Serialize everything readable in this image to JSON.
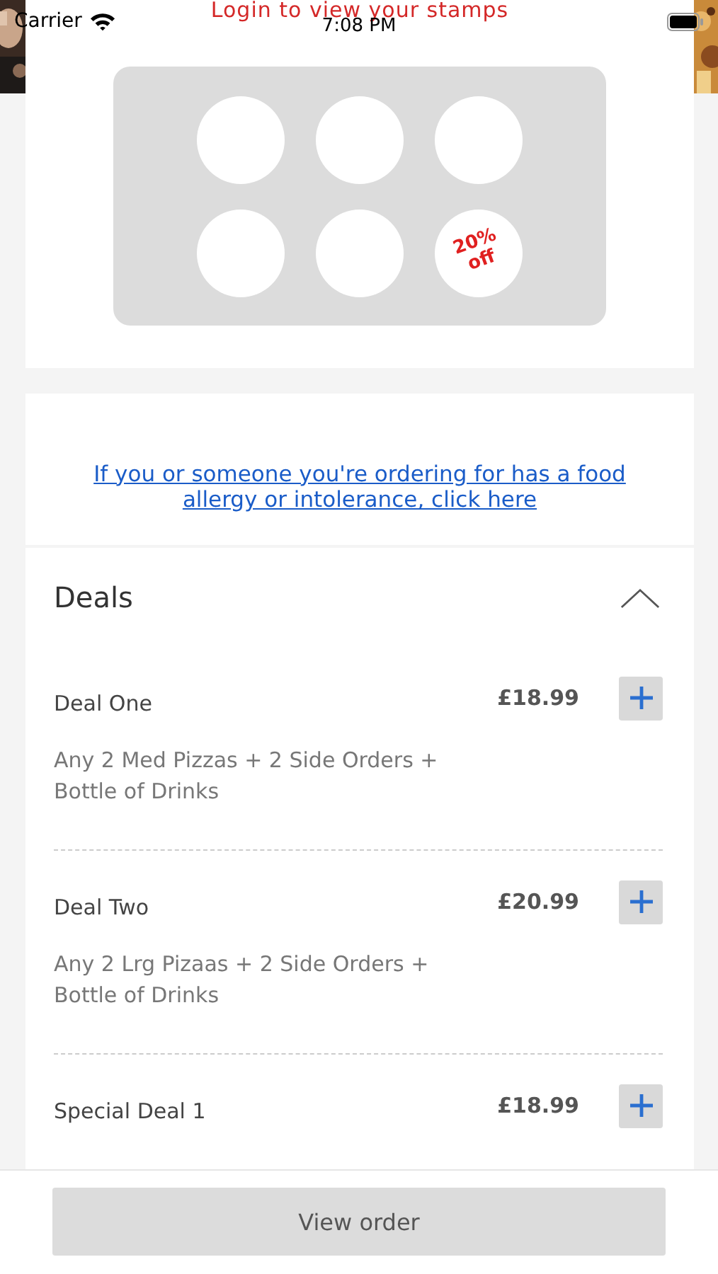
{
  "status_bar": {
    "carrier": "Carrier",
    "time": "7:08 PM"
  },
  "loyalty": {
    "title": "Login to view your stamps",
    "stamps": [
      {
        "kind": "empty"
      },
      {
        "kind": "empty"
      },
      {
        "kind": "empty"
      },
      {
        "kind": "empty"
      },
      {
        "kind": "empty"
      },
      {
        "kind": "reward",
        "label": "20% off"
      }
    ]
  },
  "allergy_link": "If you or someone you're ordering for has a food allergy or intolerance, click here",
  "deals": {
    "title": "Deals",
    "expanded": true,
    "items": [
      {
        "name": "Deal One",
        "price": "£18.99",
        "description": "Any 2 Med Pizzas + 2 Side Orders + Bottle of Drinks"
      },
      {
        "name": "Deal Two",
        "price": "£20.99",
        "description": "Any 2 Lrg Pizaas + 2 Side Orders + Bottle of Drinks"
      },
      {
        "name": "Special Deal 1",
        "price": "£18.99"
      }
    ]
  },
  "view_order_button": "View order"
}
